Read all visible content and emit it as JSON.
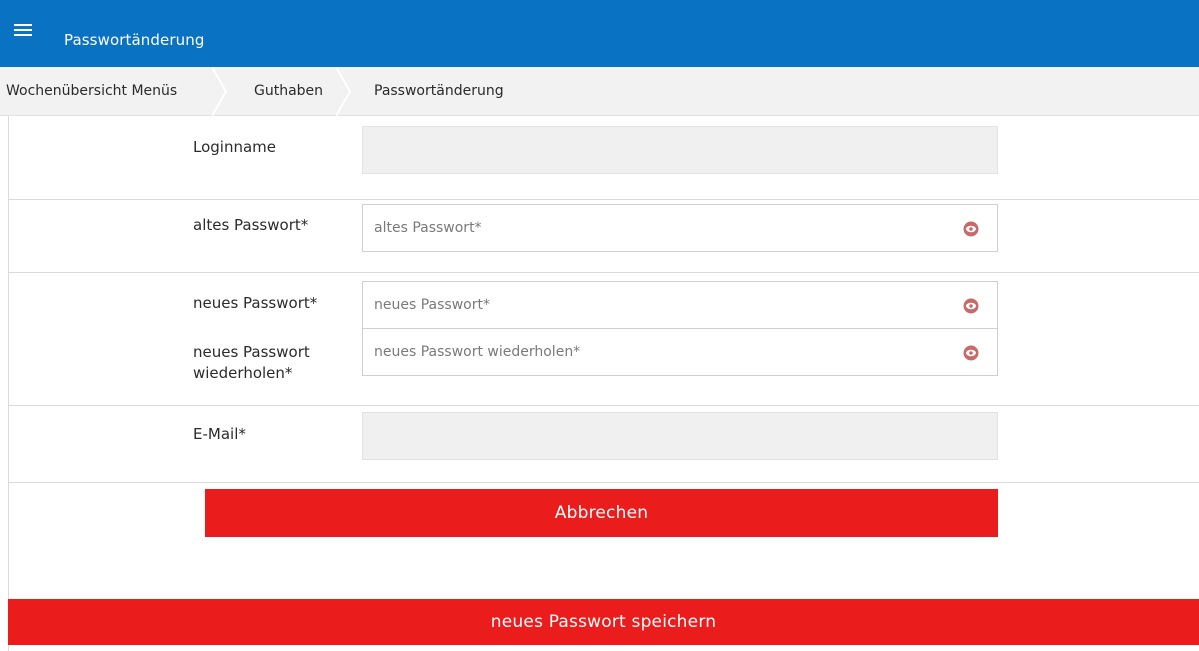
{
  "app_bar": {
    "title": "Passwortänderung",
    "menu_icon": "hamburger-menu-icon",
    "background": "#0a72c2"
  },
  "breadcrumb": {
    "items": [
      {
        "label": "Wochenübersicht Menüs"
      },
      {
        "label": "Guthaben"
      },
      {
        "label": "Passwortänderung"
      }
    ],
    "separator_icon": "chevron-right-icon"
  },
  "form": {
    "loginname": {
      "label": "Loginname",
      "value": ""
    },
    "old_password": {
      "label": "altes Passwort*",
      "placeholder": "altes Passwort*",
      "value": ""
    },
    "new_password": {
      "label": "neues Passwort*",
      "placeholder": "neues Passwort*",
      "value": ""
    },
    "repeat_password": {
      "label_line1": "neues Passwort",
      "label_line2": "wiederholen*",
      "placeholder": "neues Passwort wiederholen*",
      "value": ""
    },
    "email": {
      "label": "E-Mail*",
      "value": ""
    },
    "eye_icon": "eye-icon"
  },
  "buttons": {
    "cancel": "Abbrechen",
    "save": "neues Passwort speichern",
    "color": "#ea1c1c"
  }
}
